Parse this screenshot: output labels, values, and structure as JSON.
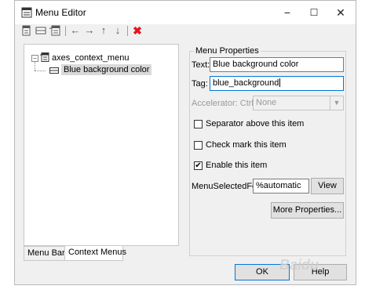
{
  "window": {
    "title": "Menu Editor",
    "app_icon": "menu-editor-icon",
    "controls": {
      "minimize": "−",
      "maximize": "☐",
      "close": "✕"
    }
  },
  "toolbar": {
    "icons": [
      "new-menu-icon",
      "new-menu-item-icon",
      "new-context-menu-icon",
      "move-left-icon",
      "move-right-icon",
      "move-up-icon",
      "move-down-icon",
      "delete-icon"
    ],
    "glyphs": {
      "left": "←",
      "right": "→",
      "up": "↑",
      "down": "↓",
      "delete": "✖"
    }
  },
  "tree": {
    "expander": "−",
    "root": {
      "label": "axes_context_menu",
      "icon": "context-menu-icon"
    },
    "child": {
      "label": "Blue background color",
      "icon": "menu-item-icon",
      "selected": true
    }
  },
  "tabs": [
    {
      "label": "Menu Bar",
      "active": false
    },
    {
      "label": "Context Menus",
      "active": true
    }
  ],
  "properties": {
    "group_title": "Menu Properties",
    "text_label": "Text:",
    "text_value": "Blue background color",
    "tag_label": "Tag:",
    "tag_value": "blue_background",
    "accelerator_label": "Accelerator: Ctrl +",
    "accelerator_value": "None",
    "separator_label": "Separator above this item",
    "separator_checked": false,
    "checkmark_label": "Check mark this item",
    "checkmark_checked": false,
    "enable_label": "Enable this item",
    "enable_checked": true,
    "callback_label": "MenuSelectedFcn:",
    "callback_value": "%automatic",
    "view_label": "View",
    "more_label": "More Properties...",
    "check_glyph": "✔",
    "dropdown_glyph": "▼"
  },
  "footer": {
    "ok_label": "OK",
    "help_label": "Help"
  },
  "watermark": "Baidu"
}
